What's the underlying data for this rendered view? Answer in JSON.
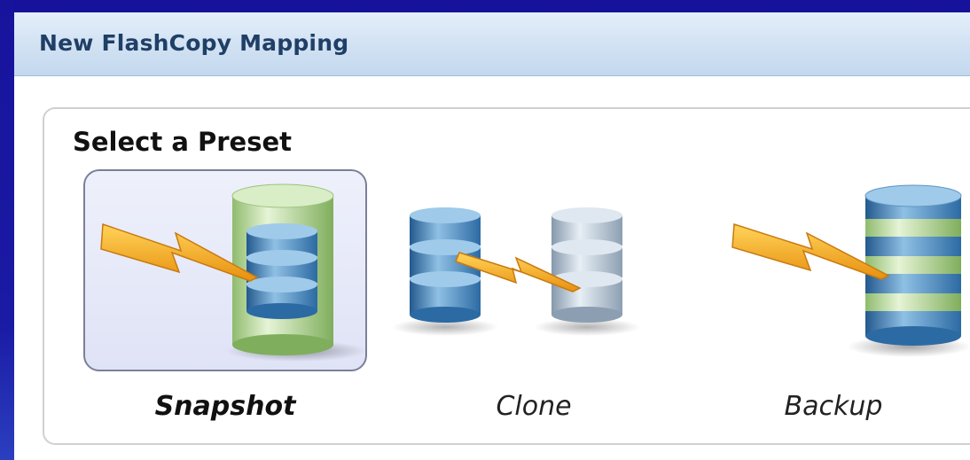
{
  "dialog": {
    "title": "New FlashCopy Mapping"
  },
  "preset_group": {
    "title": "Select a Preset",
    "selected": "Snapshot",
    "presets": [
      {
        "label": "Snapshot",
        "icon": "snapshot-icon",
        "selected": true
      },
      {
        "label": "Clone",
        "icon": "clone-icon",
        "selected": false
      },
      {
        "label": "Backup",
        "icon": "backup-icon",
        "selected": false
      }
    ]
  },
  "colors": {
    "frame": "#17129b",
    "title_bar": "#d6e5f5",
    "title_text": "#1f3f66",
    "selected_tile": "#e4e7f7",
    "lightning": "#f2a51b",
    "blue_disk": "#3d7fb6",
    "green_disk": "#b7d89a",
    "gray_disk": "#b9c8d6"
  }
}
